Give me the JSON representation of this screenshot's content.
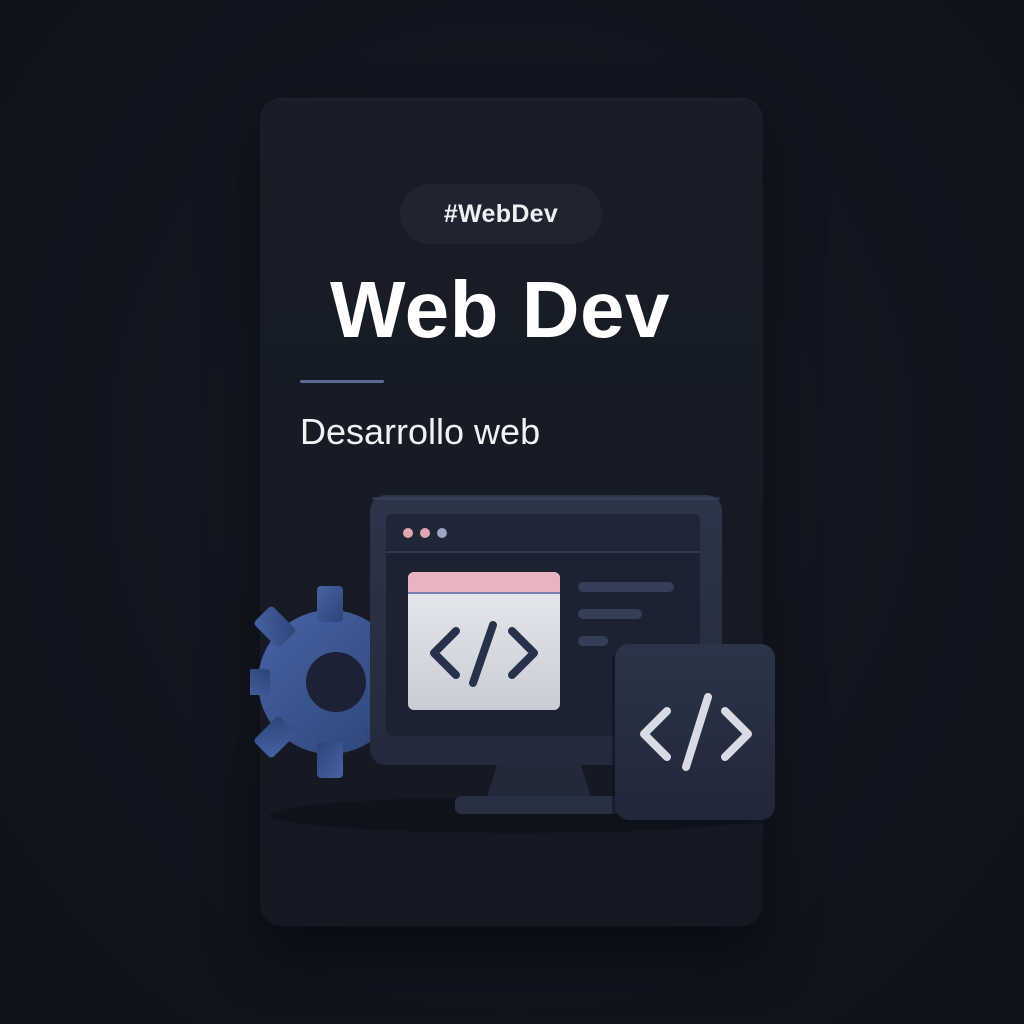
{
  "tag": {
    "label": "#WebDev"
  },
  "header": {
    "title": "Web Dev",
    "subtitle": "Desarrollo web"
  },
  "illustration": {
    "icons": [
      "gear-icon",
      "monitor-icon",
      "browser-window-icon",
      "code-icon",
      "code-tile-icon"
    ],
    "colors": {
      "background": "#10141c",
      "card": "#161b26",
      "pill": "#1f2430",
      "monitor": "#2a3347",
      "gear": "#3a5490",
      "accent_pink": "#e8b4bf",
      "code_window": "#dfe2e8",
      "rule": "#5b6a99"
    }
  }
}
